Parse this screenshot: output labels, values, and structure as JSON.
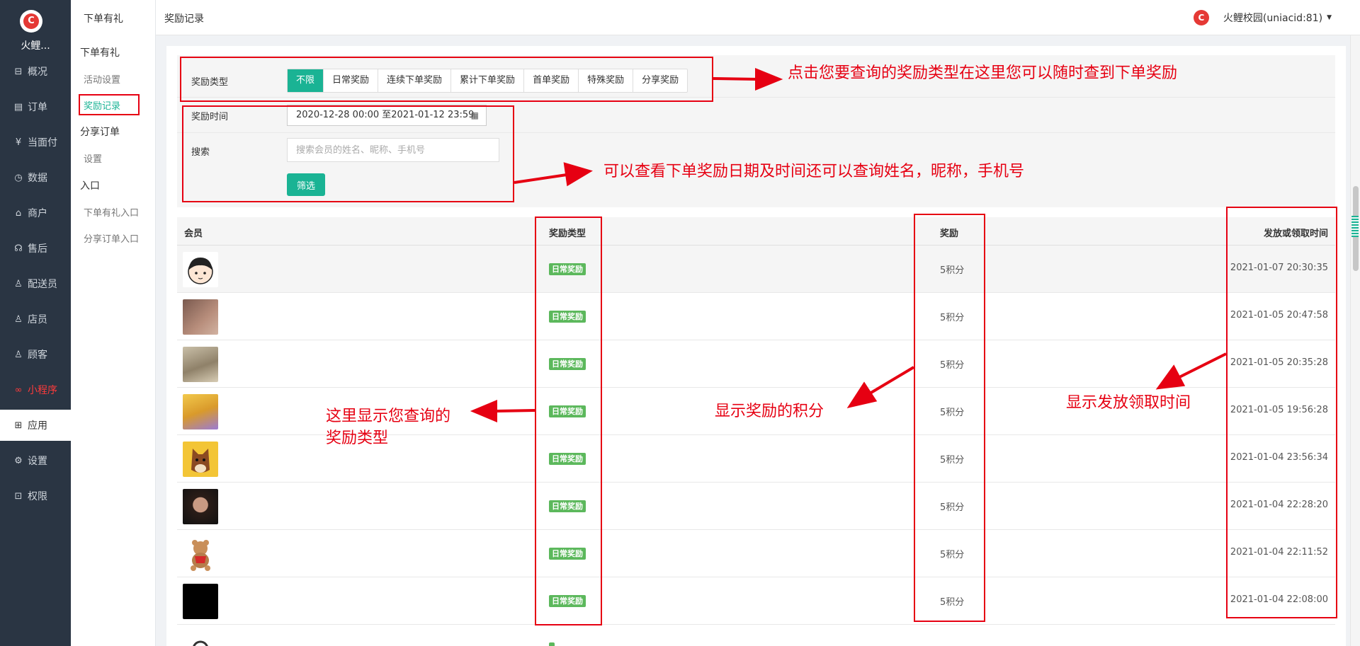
{
  "sidebar": {
    "shop_name": "火鲤...",
    "items": [
      {
        "label": "概况",
        "icon": "overview-icon",
        "glyph": "⊟"
      },
      {
        "label": "订单",
        "icon": "order-icon",
        "glyph": "▤"
      },
      {
        "label": "当面付",
        "icon": "yuan-icon",
        "glyph": "¥"
      },
      {
        "label": "数据",
        "icon": "chart-icon",
        "glyph": "◷"
      },
      {
        "label": "商户",
        "icon": "store-icon",
        "glyph": "⌂"
      },
      {
        "label": "售后",
        "icon": "service-icon",
        "glyph": "☊"
      },
      {
        "label": "配送员",
        "icon": "courier-icon",
        "glyph": "♙"
      },
      {
        "label": "店员",
        "icon": "clerk-icon",
        "glyph": "♙"
      },
      {
        "label": "顾客",
        "icon": "customer-icon",
        "glyph": "♙"
      },
      {
        "label": "小程序",
        "icon": "miniapp-icon",
        "glyph": "∞"
      },
      {
        "label": "应用",
        "icon": "apps-icon",
        "glyph": "⊞"
      },
      {
        "label": "设置",
        "icon": "settings-icon",
        "glyph": "⚙"
      },
      {
        "label": "权限",
        "icon": "lock-icon",
        "glyph": "⊡"
      }
    ]
  },
  "subnav": {
    "title": "下单有礼",
    "group1": "下单有礼",
    "link1": "活动设置",
    "link2": "奖励记录",
    "group2": "分享订单",
    "link3": "设置",
    "group3": "入口",
    "link4": "下单有礼入口",
    "link5": "分享订单入口"
  },
  "header": {
    "breadcrumb": "奖励记录",
    "user": "火鲤校园(uniacid:81)"
  },
  "filter": {
    "type_label": "奖励类型",
    "types": [
      "不限",
      "日常奖励",
      "连续下单奖励",
      "累计下单奖励",
      "首单奖励",
      "特殊奖励",
      "分享奖励"
    ],
    "time_label": "奖励时间",
    "date_range": "2020-12-28 00:00 至2021-01-12 23:59",
    "search_label": "搜索",
    "search_placeholder": "搜索会员的姓名、昵称、手机号",
    "filter_button": "筛选"
  },
  "table": {
    "headers": {
      "member": "会员",
      "type": "奖励类型",
      "reward": "奖励",
      "time": "发放或领取时间"
    },
    "rows": [
      {
        "type": "日常奖励",
        "reward": "5积分",
        "time": "2021-01-07 20:30:35"
      },
      {
        "type": "日常奖励",
        "reward": "5积分",
        "time": "2021-01-05 20:47:58"
      },
      {
        "type": "日常奖励",
        "reward": "5积分",
        "time": "2021-01-05 20:35:28"
      },
      {
        "type": "日常奖励",
        "reward": "5积分",
        "time": "2021-01-05 19:56:28"
      },
      {
        "type": "日常奖励",
        "reward": "5积分",
        "time": "2021-01-04 23:56:34"
      },
      {
        "type": "日常奖励",
        "reward": "5积分",
        "time": "2021-01-04 22:28:20"
      },
      {
        "type": "日常奖励",
        "reward": "5积分",
        "time": "2021-01-04 22:11:52"
      },
      {
        "type": "日常奖励",
        "reward": "5积分",
        "time": "2021-01-04 22:08:00"
      }
    ]
  },
  "annotations": {
    "type_note": "点击您要查询的奖励类型在这里您可以随时查到下单奖励",
    "time_note": "可以查看下单奖励日期及时间还可以查询姓名，昵称，手机号",
    "type_col_note_1": "这里显示您查询的",
    "type_col_note_2": "奖励类型",
    "reward_note": "显示奖励的积分",
    "time_col_note": "显示发放领取时间"
  },
  "colors": {
    "accent": "#1ab394",
    "annotation": "#e60012",
    "sidebar": "#2a3543",
    "badge": "#5cb85c"
  }
}
